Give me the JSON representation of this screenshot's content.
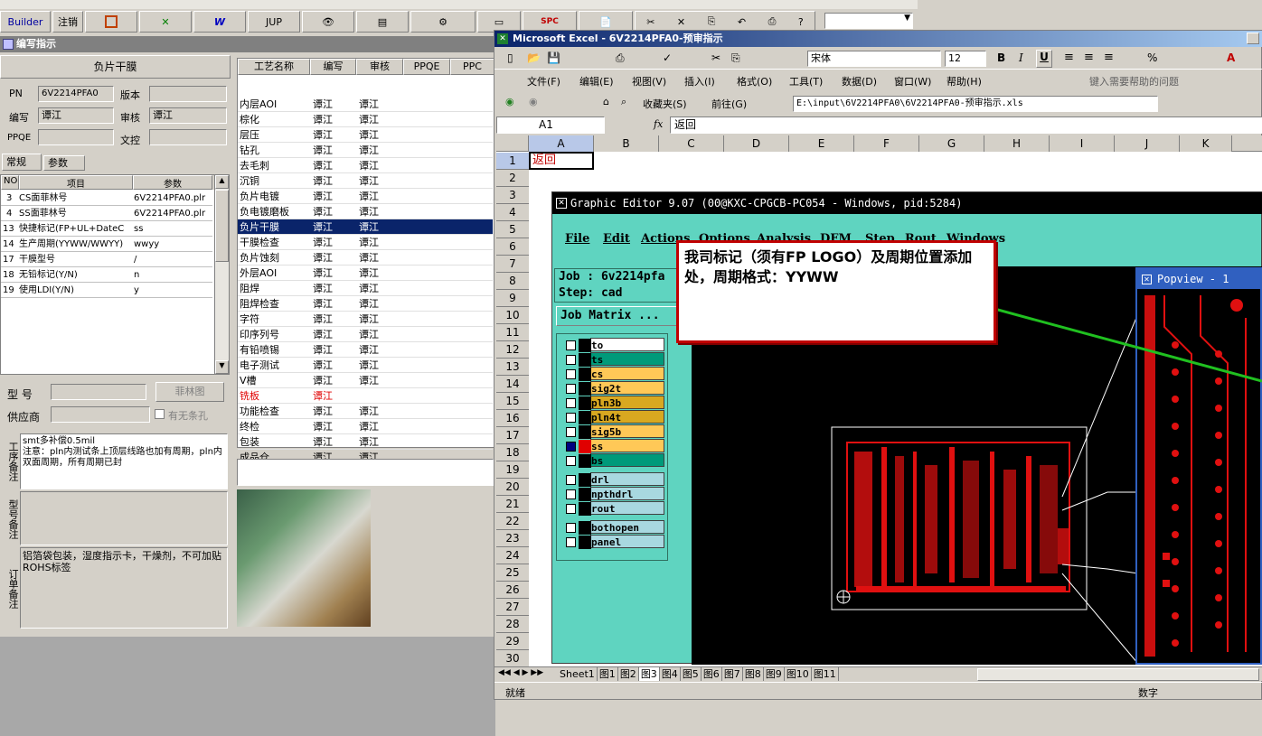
{
  "topbar": {
    "builder": "Builder",
    "logout": "注销",
    "jup": "JUP",
    "spc": "SPC"
  },
  "left": {
    "title": "编写指示",
    "section_title": "负片干膜",
    "fields": [
      {
        "label": "PN",
        "value": "6V2214PFA0",
        "label2": "版本",
        "value2": ""
      },
      {
        "label": "编写",
        "value": "谭江",
        "label2": "审核",
        "value2": "谭江"
      },
      {
        "label": "PPQE",
        "value": "",
        "label2": "文控",
        "value2": ""
      }
    ],
    "tabs": [
      "常规",
      "参数"
    ],
    "grid_headers": [
      "NO",
      "项目",
      "参数"
    ],
    "grid_rows": [
      {
        "no": "3",
        "item": "CS面菲林号",
        "param": "6V2214PFA0.plr"
      },
      {
        "no": "4",
        "item": "SS面菲林号",
        "param": "6V2214PFA0.plr"
      },
      {
        "no": "13",
        "item": "快捷标记(FP+UL+DateC",
        "param": "ss"
      },
      {
        "no": "14",
        "item": "生产周期(YYWW/WWYY)",
        "param": "wwyy"
      },
      {
        "no": "17",
        "item": "干膜型号",
        "param": "/"
      },
      {
        "no": "18",
        "item": "无铅标记(Y/N)",
        "param": "n"
      },
      {
        "no": "19",
        "item": "使用LDI(Y/N)",
        "param": "y"
      }
    ],
    "model_label": "型  号",
    "supplier_label": "供应商",
    "film_button": "菲林图",
    "no_hole_label": "有无条孔",
    "note1_label": "工序备注",
    "note1_text": "smt多补偿0.5mil\n注意：pln内测试条上顶层线路也加有周期，pln内双面周期，所有周期已封",
    "note2_label": "型号备注",
    "note3_label": "订单备注",
    "note3_text": "铝箔袋包装，湿度指示卡，干燥剂，不可加贴ROHS标签"
  },
  "process": {
    "headers": [
      "工艺名称",
      "编写",
      "审核",
      "PPQE",
      "PPC"
    ],
    "rows": [
      {
        "name": "内层AOI",
        "w": "谭江",
        "r": "谭江"
      },
      {
        "name": "棕化",
        "w": "谭江",
        "r": "谭江"
      },
      {
        "name": "层压",
        "w": "谭江",
        "r": "谭江"
      },
      {
        "name": "钻孔",
        "w": "谭江",
        "r": "谭江"
      },
      {
        "name": "去毛刺",
        "w": "谭江",
        "r": "谭江"
      },
      {
        "name": "沉铜",
        "w": "谭江",
        "r": "谭江"
      },
      {
        "name": "负片电镀",
        "w": "谭江",
        "r": "谭江"
      },
      {
        "name": "负电镀磨板",
        "w": "谭江",
        "r": "谭江"
      },
      {
        "name": "负片干膜",
        "w": "谭江",
        "r": "谭江"
      },
      {
        "name": "干膜检查",
        "w": "谭江",
        "r": "谭江"
      },
      {
        "name": "负片蚀刻",
        "w": "谭江",
        "r": "谭江"
      },
      {
        "name": "外层AOI",
        "w": "谭江",
        "r": "谭江"
      },
      {
        "name": "阻焊",
        "w": "谭江",
        "r": "谭江"
      },
      {
        "name": "阻焊检查",
        "w": "谭江",
        "r": "谭江"
      },
      {
        "name": "字符",
        "w": "谭江",
        "r": "谭江"
      },
      {
        "name": "印序列号",
        "w": "谭江",
        "r": "谭江"
      },
      {
        "name": "有铅喷锡",
        "w": "谭江",
        "r": "谭江"
      },
      {
        "name": "电子测试",
        "w": "谭江",
        "r": "谭江"
      },
      {
        "name": "V槽",
        "w": "谭江",
        "r": "谭江"
      },
      {
        "name": "铣板",
        "w": "谭江",
        "r": ""
      },
      {
        "name": "功能检查",
        "w": "谭江",
        "r": "谭江"
      },
      {
        "name": "终检",
        "w": "谭江",
        "r": "谭江"
      },
      {
        "name": "包装",
        "w": "谭江",
        "r": "谭江"
      },
      {
        "name": "成品仓",
        "w": "谭江",
        "r": "谭江"
      }
    ]
  },
  "excel": {
    "title": "Microsoft Excel - 6V2214PFA0-预审指示",
    "menu": [
      "文件(F)",
      "编辑(E)",
      "视图(V)",
      "插入(I)",
      "格式(O)",
      "工具(T)",
      "数据(D)",
      "窗口(W)",
      "帮助(H)"
    ],
    "font": "宋体",
    "font_size": "12",
    "help_placeholder": "键入需要帮助的问题",
    "favorites": "收藏夹(S)",
    "goto": "前往(G)",
    "path": "E:\\input\\6V2214PFA0\\6V2214PFA0-预审指示.xls",
    "cell_ref": "A1",
    "formula": "返回",
    "columns": [
      "A",
      "B",
      "C",
      "D",
      "E",
      "F",
      "G",
      "H",
      "I",
      "J",
      "K"
    ],
    "rows": [
      "1",
      "2",
      "3",
      "4",
      "5",
      "6",
      "7",
      "8",
      "9",
      "10",
      "11",
      "12",
      "13",
      "14",
      "15",
      "16",
      "17",
      "18",
      "19",
      "20",
      "21",
      "22",
      "23",
      "24",
      "25",
      "26",
      "27",
      "28",
      "29",
      "30"
    ],
    "a1_value": "返回",
    "sheet_tabs": [
      "Sheet1",
      "图1",
      "图2",
      "图3",
      "图4",
      "图5",
      "图6",
      "图7",
      "图8",
      "图9",
      "图10",
      "图11"
    ],
    "status": "就绪",
    "status_right": "数字"
  },
  "ged": {
    "title": "Graphic Editor 9.07 (00@KXC-CPGCB-PC054 - Windows, pid:5284)",
    "menu": [
      "File",
      "Edit",
      "Actions",
      "Options",
      "Analysis",
      "DFM",
      "Step",
      "Rout",
      "Windows"
    ],
    "job": "Job : 6v2214pfa",
    "step": "Step: cad",
    "matrix": "Job Matrix ...",
    "layers": [
      {
        "name": "to",
        "color": "#ffffff"
      },
      {
        "name": "ts",
        "color": "#009a7a"
      },
      {
        "name": "cs",
        "color": "#ffc857"
      },
      {
        "name": "sig2t",
        "color": "#ffc857"
      },
      {
        "name": "pln3b",
        "color": "#d8a820"
      },
      {
        "name": "pln4t",
        "color": "#d8a820"
      },
      {
        "name": "sig5b",
        "color": "#ffc857"
      },
      {
        "name": "ss",
        "color": "#ffc857"
      },
      {
        "name": "bs",
        "color": "#009a7a"
      },
      {
        "name": "drl",
        "color": "#a8d8e0"
      },
      {
        "name": "npthdrl",
        "color": "#a8d8e0"
      },
      {
        "name": "rout",
        "color": "#a8d8e0"
      },
      {
        "name": "bothopen",
        "color": "#a8d8e0"
      },
      {
        "name": "panel",
        "color": "#a8d8e0"
      }
    ],
    "popview_title": "Popview - 1",
    "callout": "我司标记（须有FP LOGO）及周期位置添加处，周期格式：YYWW"
  }
}
